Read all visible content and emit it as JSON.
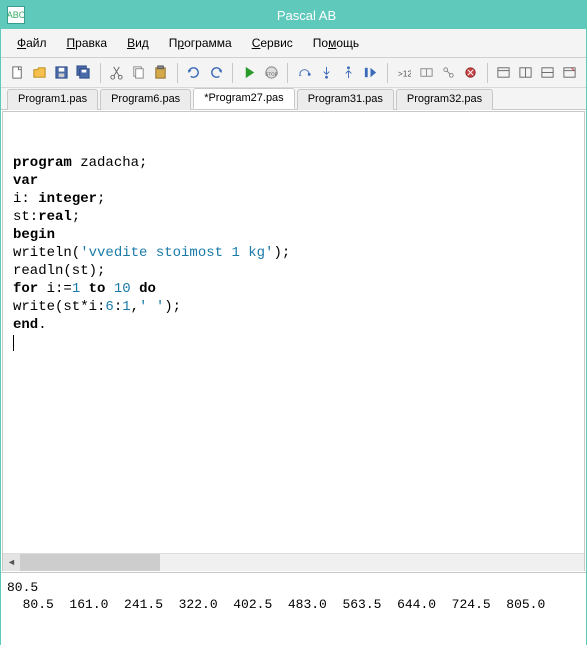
{
  "title": "Pascal AB",
  "app_icon": "ABC",
  "menu": [
    "Файл",
    "Правка",
    "Вид",
    "Программа",
    "Сервис",
    "Помощь"
  ],
  "menu_underline_idx": [
    0,
    0,
    0,
    1,
    0,
    2
  ],
  "tabs": [
    {
      "label": "Program1.pas",
      "active": false
    },
    {
      "label": "Program6.pas",
      "active": false
    },
    {
      "label": "*Program27.pas",
      "active": true
    },
    {
      "label": "Program31.pas",
      "active": false
    },
    {
      "label": "Program32.pas",
      "active": false
    }
  ],
  "code": {
    "lines": [
      [
        {
          "t": "program",
          "c": "kw"
        },
        {
          "t": " zadacha;",
          "c": "ident"
        }
      ],
      [
        {
          "t": "var",
          "c": "kw"
        }
      ],
      [
        {
          "t": "i: ",
          "c": "ident"
        },
        {
          "t": "integer",
          "c": "type"
        },
        {
          "t": ";",
          "c": "ident"
        }
      ],
      [
        {
          "t": "st:",
          "c": "ident"
        },
        {
          "t": "real",
          "c": "type"
        },
        {
          "t": ";",
          "c": "ident"
        }
      ],
      [
        {
          "t": "begin",
          "c": "kw"
        }
      ],
      [
        {
          "t": "writeln(",
          "c": "ident"
        },
        {
          "t": "'vvedite stoimost 1 kg'",
          "c": "str"
        },
        {
          "t": ");",
          "c": "ident"
        }
      ],
      [
        {
          "t": "readln(st);",
          "c": "ident"
        }
      ],
      [
        {
          "t": "for",
          "c": "kw"
        },
        {
          "t": " i:=",
          "c": "ident"
        },
        {
          "t": "1",
          "c": "num"
        },
        {
          "t": " ",
          "c": "ident"
        },
        {
          "t": "to",
          "c": "kw"
        },
        {
          "t": " ",
          "c": "ident"
        },
        {
          "t": "10",
          "c": "num"
        },
        {
          "t": " ",
          "c": "ident"
        },
        {
          "t": "do",
          "c": "kw"
        }
      ],
      [
        {
          "t": "write(st*i:",
          "c": "ident"
        },
        {
          "t": "6",
          "c": "num"
        },
        {
          "t": ":",
          "c": "ident"
        },
        {
          "t": "1",
          "c": "num"
        },
        {
          "t": ",",
          "c": "ident"
        },
        {
          "t": "' '",
          "c": "str"
        },
        {
          "t": ");",
          "c": "ident"
        }
      ],
      [
        {
          "t": "end",
          "c": "kw"
        },
        {
          "t": ".",
          "c": "ident"
        }
      ]
    ]
  },
  "output": "80.5\n  80.5  161.0  241.5  322.0  402.5  483.0  563.5  644.0  724.5  805.0",
  "toolbar_icons": [
    "new",
    "open",
    "save",
    "saveall",
    "sep",
    "cut",
    "copy",
    "paste",
    "sep",
    "undo",
    "redo",
    "sep",
    "run",
    "stop",
    "sep",
    "stepover",
    "stepinto",
    "stepout",
    "runtocursor",
    "sep",
    "watch",
    "locals",
    "callstack",
    "breakpoint",
    "sep",
    "window1",
    "window2",
    "window3",
    "window4"
  ]
}
